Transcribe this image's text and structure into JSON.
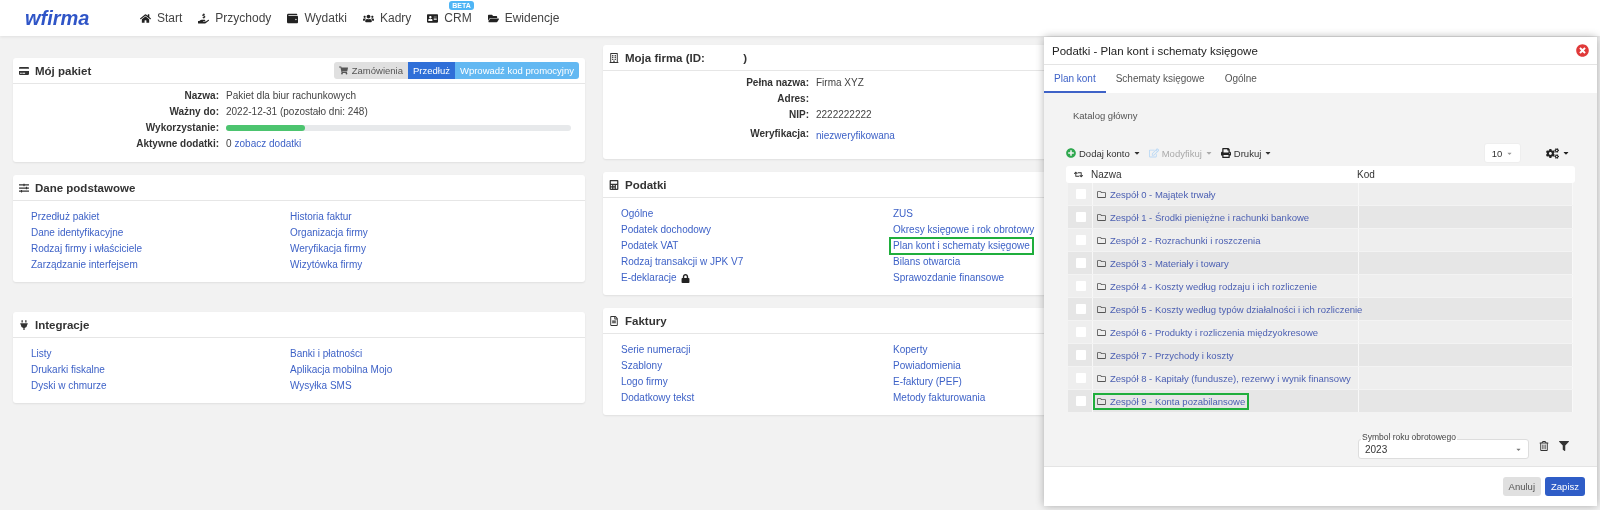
{
  "nav": {
    "logo": "wfirma",
    "items": [
      {
        "label": "Start"
      },
      {
        "label": "Przychody"
      },
      {
        "label": "Wydatki"
      },
      {
        "label": "Kadry"
      },
      {
        "label": "CRM",
        "badge": "BETA"
      },
      {
        "label": "Ewidencje"
      }
    ]
  },
  "left_cards": [
    {
      "title": "Mój pakiet",
      "kind": "details",
      "actions": [
        {
          "label": "Zamówienia",
          "kind": "default"
        },
        {
          "label": "Przedłuż",
          "kind": "primary"
        },
        {
          "label": "Wprowadź kod promocyjny",
          "kind": "info"
        }
      ],
      "fields": [
        {
          "label": "Nazwa:",
          "kind": "text",
          "value": "Pakiet dla biur rachunkowych"
        },
        {
          "label": "Ważny do:",
          "kind": "text",
          "value": "2022-12-31 (pozostało dni: 248)"
        },
        {
          "label": "Wykorzystanie:",
          "kind": "progress",
          "level": 0.23
        },
        {
          "label": "Aktywne dodatki:",
          "kind": "count_link",
          "value": "0",
          "link": "zobacz dodatki"
        }
      ]
    },
    {
      "title": "Dane podstawowe",
      "kind": "links",
      "links": [
        [
          {
            "label": "Przedłuż pakiet"
          },
          {
            "label": "Dane identyfikacyjne"
          },
          {
            "label": "Rodzaj firmy i właściciele"
          },
          {
            "label": "Zarządzanie interfejsem"
          }
        ],
        [
          {
            "label": "Historia faktur"
          },
          {
            "label": "Organizacja firmy"
          },
          {
            "label": "Weryfikacja firmy"
          },
          {
            "label": "Wizytówka firmy"
          }
        ]
      ]
    },
    {
      "title": "Integracje",
      "kind": "links",
      "links": [
        [
          {
            "label": "Listy"
          },
          {
            "label": "Drukarki fiskalne"
          },
          {
            "label": "Dyski w chmurze"
          }
        ],
        [
          {
            "label": "Banki i płatności"
          },
          {
            "label": "Aplikacja mobilna Mojo"
          },
          {
            "label": "Wysyłka SMS"
          }
        ]
      ]
    }
  ],
  "right_cards": [
    {
      "title": "Moja firma (ID:            )",
      "kind": "details",
      "fields": [
        {
          "label": "Pełna nazwa:",
          "kind": "text",
          "value": "Firma XYZ"
        },
        {
          "label": "Adres:",
          "kind": "text"
        },
        {
          "label": "NIP:",
          "kind": "text",
          "value": "2222222222"
        },
        {
          "label": "Weryfikacja:",
          "kind": "link",
          "value": "niezweryfikowana"
        }
      ]
    },
    {
      "title": "Podatki",
      "kind": "links",
      "links": [
        [
          {
            "label": "Ogólne",
            "locked": false,
            "highlighted": false
          },
          {
            "label": "Podatek dochodowy",
            "locked": false,
            "highlighted": false
          },
          {
            "label": "Podatek VAT",
            "locked": false,
            "highlighted": false
          },
          {
            "label": "Rodzaj transakcji w JPK V7",
            "locked": false,
            "highlighted": false
          },
          {
            "label": "E-deklaracje",
            "locked": true,
            "highlighted": false
          }
        ],
        [
          {
            "label": "ZUS",
            "locked": false,
            "highlighted": false
          },
          {
            "label": "Okresy księgowe i rok obrotowy",
            "locked": false,
            "highlighted": false
          },
          {
            "label": "Plan kont i schematy księgowe",
            "locked": false,
            "highlighted": true
          },
          {
            "label": "Bilans otwarcia",
            "locked": false,
            "highlighted": false
          },
          {
            "label": "Sprawozdanie finansowe",
            "locked": false,
            "highlighted": false
          }
        ]
      ]
    },
    {
      "title": "Faktury",
      "kind": "links",
      "links": [
        [
          {
            "label": "Serie numeracji"
          },
          {
            "label": "Szablony"
          },
          {
            "label": "Logo firmy"
          },
          {
            "label": "Dodatkowy tekst"
          }
        ],
        [
          {
            "label": "Koperty"
          },
          {
            "label": "Powiadomienia"
          },
          {
            "label": "E-faktury (PEF)"
          },
          {
            "label": "Metody fakturowania"
          }
        ]
      ]
    }
  ],
  "modal": {
    "title": "Podatki - Plan kont i schematy księgowe",
    "tabs": [
      {
        "label": "Plan kont",
        "selected": true
      },
      {
        "label": "Schematy księgowe",
        "selected": false
      },
      {
        "label": "Ogólne",
        "selected": false
      }
    ],
    "breadcrumb": "Katalog główny",
    "toolbar": [
      {
        "label": "Dodaj konto",
        "disabled": false
      },
      {
        "label": "Modyfikuj",
        "disabled": true
      },
      {
        "label": "Drukuj",
        "disabled": false
      }
    ],
    "page_size": "10",
    "table": {
      "columns": [
        "Nazwa",
        "Kod"
      ],
      "rows": [
        {
          "name": "Zespół 0 - Majątek trwały",
          "checked": false,
          "highlighted": false
        },
        {
          "name": "Zespół 1 - Środki pieniężne i rachunki bankowe",
          "checked": false,
          "highlighted": false
        },
        {
          "name": "Zespół 2 - Rozrachunki i roszczenia",
          "checked": false,
          "highlighted": false
        },
        {
          "name": "Zespół 3 - Materiały i towary",
          "checked": false,
          "highlighted": false
        },
        {
          "name": "Zespół 4 - Koszty według rodzaju i ich rozliczenie",
          "checked": false,
          "highlighted": false
        },
        {
          "name": "Zespół 5 - Koszty według typów działalności i ich rozliczenie",
          "checked": false,
          "highlighted": false
        },
        {
          "name": "Zespół 6 - Produkty i rozliczenia międzyokresowe",
          "checked": false,
          "highlighted": false
        },
        {
          "name": "Zespół 7 - Przychody i koszty",
          "checked": false,
          "highlighted": false
        },
        {
          "name": "Zespół 8 - Kapitały (fundusze), rezerwy i wynik finansowy",
          "checked": false,
          "highlighted": false
        },
        {
          "name": "Zespół 9 - Konta pozabilansowe",
          "checked": false,
          "highlighted": true
        }
      ]
    },
    "year_select": {
      "label": "Symbol roku obrotowego",
      "value": "2023"
    },
    "buttons": [
      {
        "label": "Anuluj",
        "kind": "secondary"
      },
      {
        "label": "Zapisz",
        "kind": "primary"
      }
    ]
  }
}
